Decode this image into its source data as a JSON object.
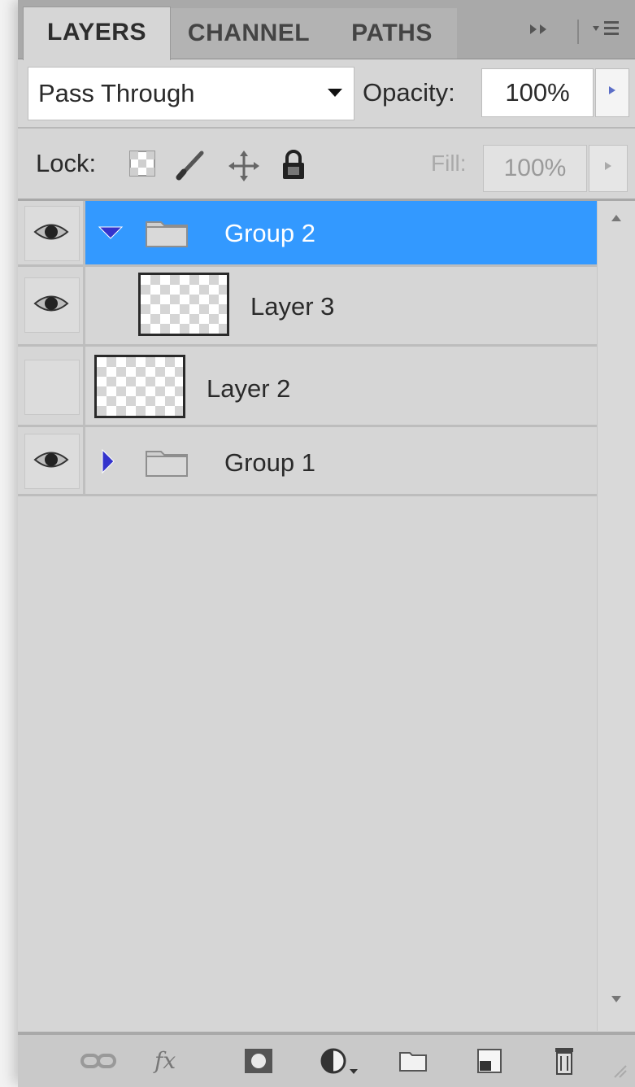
{
  "tabs": [
    {
      "label": "LAYERS",
      "active": true
    },
    {
      "label": "CHANNEL",
      "active": false
    },
    {
      "label": "PATHS",
      "active": false
    }
  ],
  "panel_controls": {
    "collapse_icon": "double-arrow-right-icon",
    "menu_icon": "panel-menu-icon"
  },
  "blend_mode": {
    "value": "Pass Through"
  },
  "opacity": {
    "label": "Opacity:",
    "value": "100%"
  },
  "lock": {
    "label": "Lock:",
    "icons": [
      "lock-transparent-icon",
      "lock-image-icon",
      "lock-position-icon",
      "lock-all-icon"
    ]
  },
  "fill": {
    "label": "Fill:",
    "value": "100%",
    "enabled": false
  },
  "layers": [
    {
      "name": "Group 2",
      "type": "group",
      "expanded": true,
      "visible": true,
      "selected": true,
      "indent": 0
    },
    {
      "name": "Layer 3",
      "type": "layer",
      "visible": true,
      "selected": false,
      "indent": 1
    },
    {
      "name": "Layer 2",
      "type": "layer",
      "visible": false,
      "selected": false,
      "indent": 0
    },
    {
      "name": "Group 1",
      "type": "group",
      "expanded": false,
      "visible": true,
      "selected": false,
      "indent": 0
    }
  ],
  "toolbar": {
    "fx_label": "fx",
    "icons": [
      "link-layers-icon",
      "add-layer-style-icon",
      "add-mask-icon",
      "new-adjustment-layer-icon",
      "new-group-icon",
      "new-layer-icon",
      "delete-layer-icon"
    ]
  },
  "colors": {
    "selection": "#3399ff",
    "panel_bg": "#d6d6d6",
    "disclosure": "#3333cc"
  }
}
